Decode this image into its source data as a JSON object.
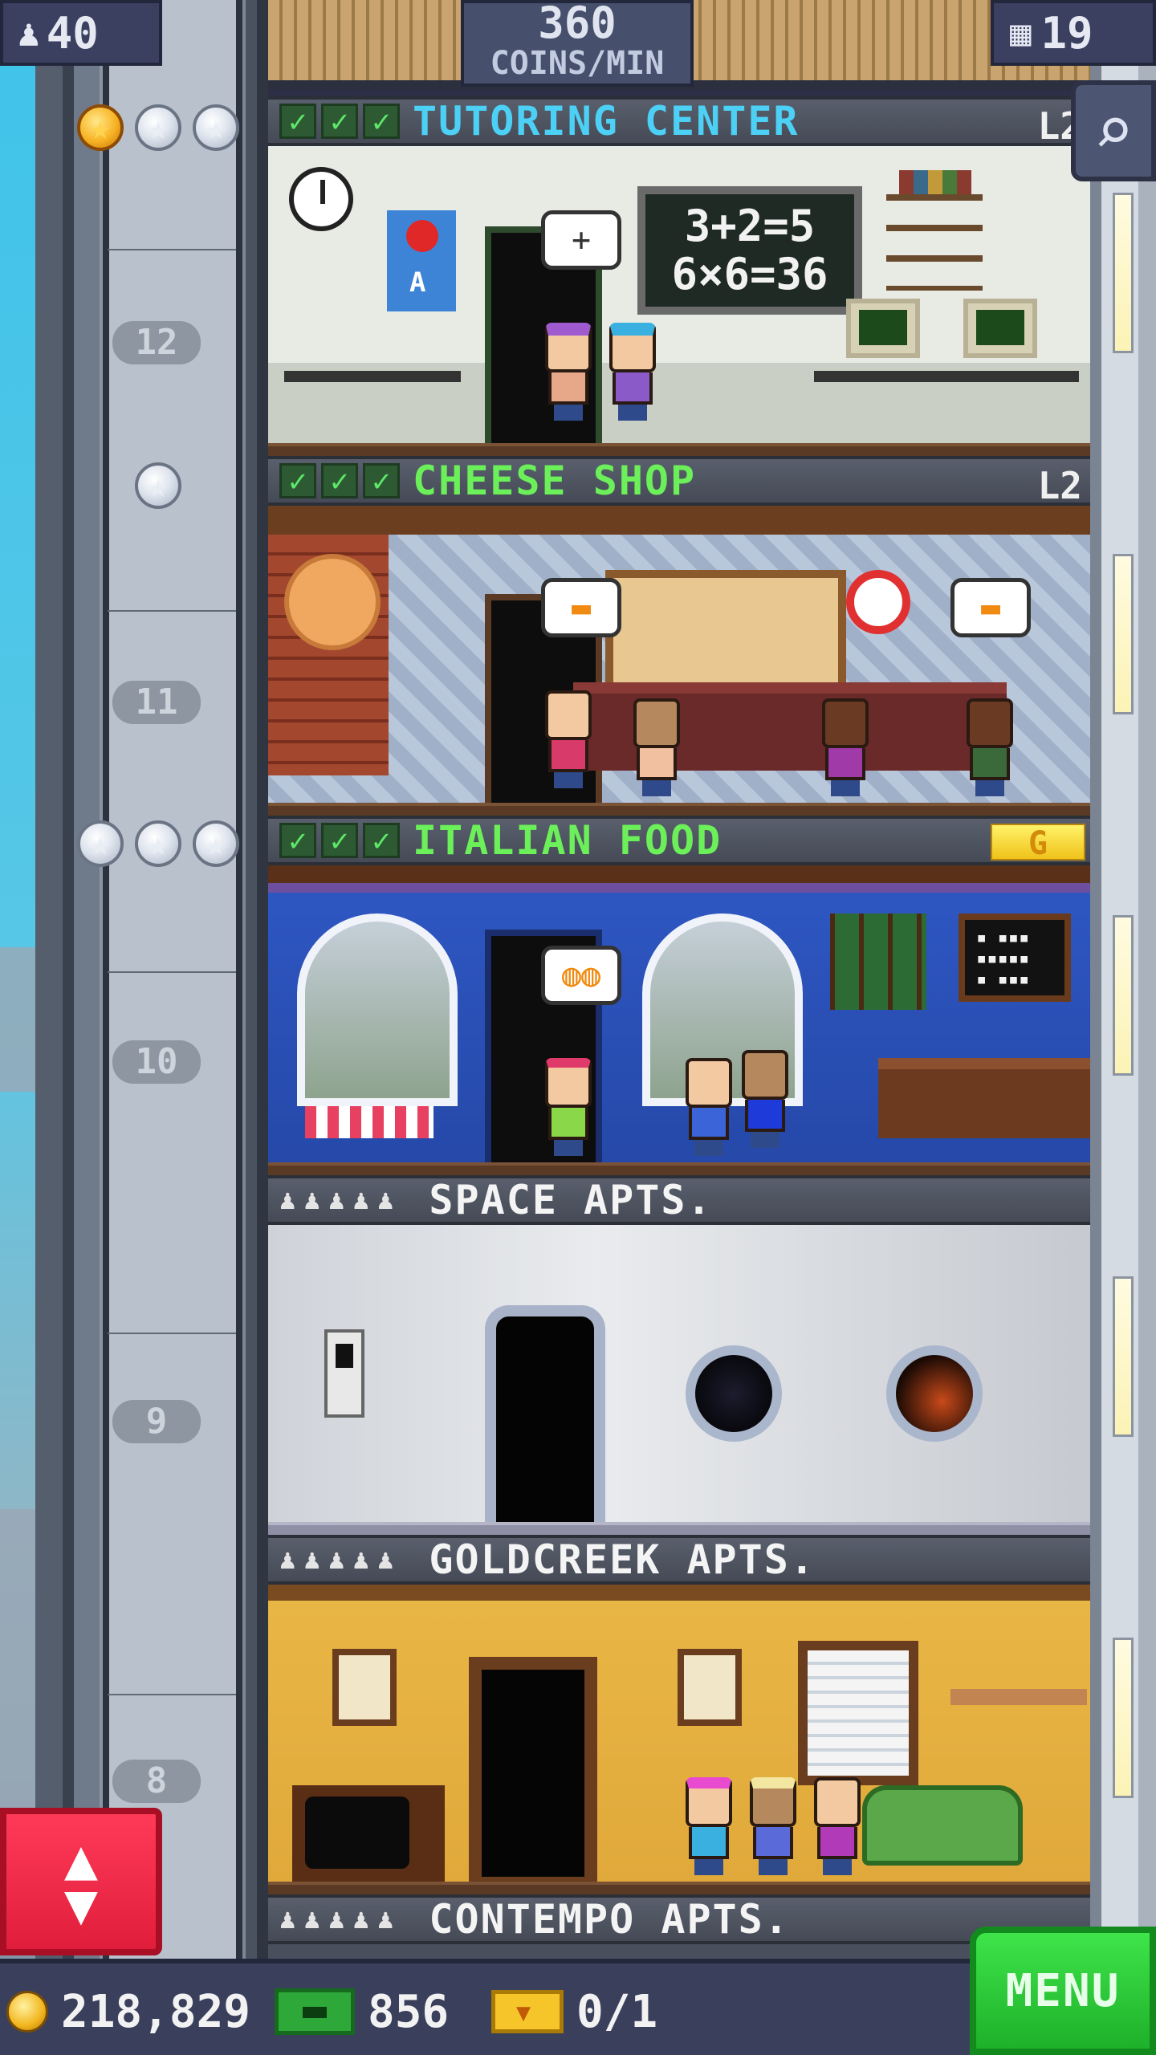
{
  "hud": {
    "population": "40",
    "coins_per_min_value": "360",
    "coins_per_min_unit": "COINS/MIN",
    "floor_count": "19"
  },
  "floors": [
    {
      "type": "tutoring",
      "name": "TUTORING CENTER",
      "level": "L2",
      "floor_number": "12",
      "stars": 1,
      "checks": 3,
      "speech": "+"
    },
    {
      "type": "cheese",
      "name": "CHEESE SHOP",
      "level": "L2",
      "floor_number": "11",
      "stars": 0,
      "checks": 3
    },
    {
      "type": "italian",
      "name": "ITALIAN FOOD",
      "level": "G",
      "floor_number": "10",
      "stars": 0,
      "checks": 3
    },
    {
      "type": "residential",
      "name": "SPACE APTS.",
      "floor_number": "9",
      "residents": 5
    },
    {
      "type": "residential",
      "name": "GOLDCREEK APTS.",
      "floor_number": "8",
      "residents": 5
    },
    {
      "type": "residential",
      "name": "CONTEMPO APTS.",
      "residents": 5
    }
  ],
  "bottom_bar": {
    "coins": "218,829",
    "bux": "856",
    "tickets": "0/1",
    "menu_label": "MENU"
  },
  "icons": {
    "population": "person-icon",
    "floors": "building-icon",
    "zoom": "magnifier-icon",
    "elevator": "up-down-arrows-icon",
    "coin": "coin-icon",
    "bux": "bux-icon",
    "ticket": "ticket-icon"
  },
  "colors": {
    "commercial_name": "#6cf05a",
    "service_name": "#4cd0f5",
    "residential_name": "#f4f4f4",
    "menu_button": "#1eb02a",
    "elevator_button": "#e01e3c"
  }
}
